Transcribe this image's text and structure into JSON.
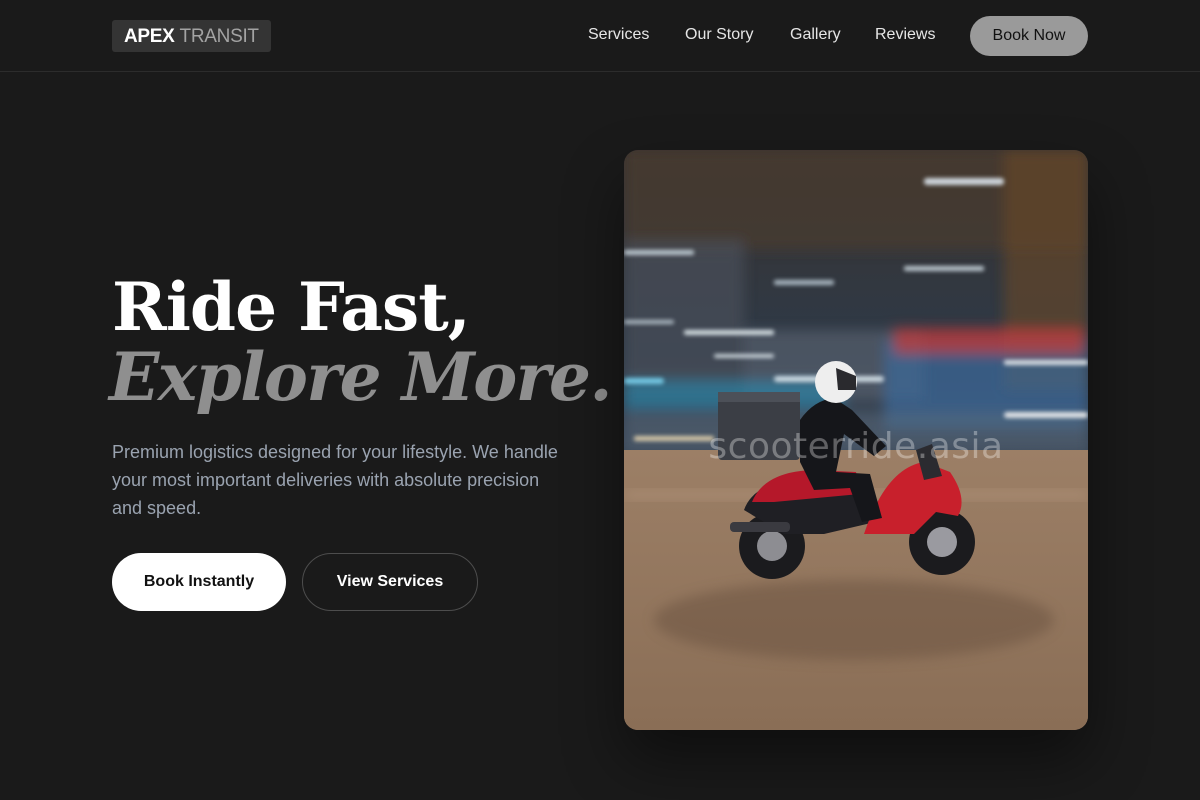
{
  "header": {
    "logo": {
      "part1": "APEX",
      "part2": "TRANSIT"
    },
    "nav": [
      {
        "label": "Services"
      },
      {
        "label": "Our Story"
      },
      {
        "label": "Gallery"
      },
      {
        "label": "Reviews"
      }
    ],
    "cta_label": "Book Now"
  },
  "hero": {
    "title_line1": "Ride Fast,",
    "title_line2": "Explore More.",
    "description": "Premium logistics designed for your lifestyle. We handle your most important deliveries with absolute precision and speed.",
    "primary_button": "Book Instantly",
    "secondary_button": "View Services",
    "image": {
      "subject": "rider-on-red-scooter-photo",
      "watermark": "scooterride.asia"
    }
  },
  "colors": {
    "background": "#1a1a1a",
    "accent_button": "#9a9a9a",
    "muted_text": "#9aa3b0",
    "scooter_red": "#c8202c"
  }
}
